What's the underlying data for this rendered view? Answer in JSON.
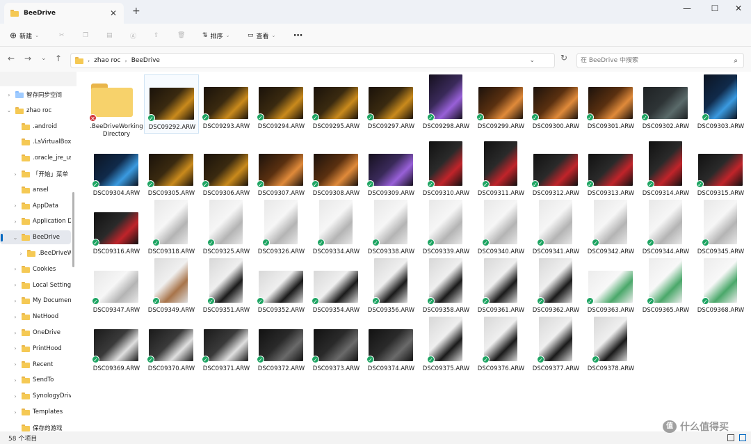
{
  "window": {
    "tab_title": "BeeDrive",
    "tab_close_icon": "close-icon",
    "new_tab_icon": "plus-icon",
    "controls": [
      "minimize-icon",
      "maximize-icon",
      "close-icon"
    ]
  },
  "toolbar": {
    "new_label": "新建",
    "sort_label": "排序",
    "view_label": "查看",
    "more_icon": "more-icon",
    "disabled_icons": [
      "cut-icon",
      "copy-icon",
      "paste-icon",
      "rename-icon",
      "share-icon",
      "delete-icon"
    ]
  },
  "address": {
    "crumbs": [
      "zhao roc",
      "BeeDrive"
    ],
    "search_placeholder": "在 BeeDrive 中搜索"
  },
  "sidebar": {
    "items": [
      {
        "label": "智存同步空间",
        "level": 0,
        "chev": "›",
        "icon": "sync-icon"
      },
      {
        "label": "zhao roc",
        "level": 0,
        "chev": "⌄",
        "icon": "folder-icon"
      },
      {
        "label": ".android",
        "level": 1,
        "chev": "",
        "icon": "folder-icon"
      },
      {
        "label": ".LsVirtualBox",
        "level": 1,
        "chev": "",
        "icon": "folder-icon"
      },
      {
        "label": ".oracle_jre_usage",
        "level": 1,
        "chev": "",
        "icon": "folder-icon"
      },
      {
        "label": "「开始」菜单",
        "level": 1,
        "chev": "›",
        "icon": "folder-icon"
      },
      {
        "label": "ansel",
        "level": 1,
        "chev": "",
        "icon": "folder-icon"
      },
      {
        "label": "AppData",
        "level": 1,
        "chev": "›",
        "icon": "folder-icon"
      },
      {
        "label": "Application Data",
        "level": 1,
        "chev": "›",
        "icon": "folder-icon"
      },
      {
        "label": "BeeDrive",
        "level": 1,
        "chev": "⌄",
        "icon": "folder-icon",
        "selected": true
      },
      {
        "label": ".BeeDriveWorkingDirectory",
        "level": 2,
        "chev": "›",
        "icon": "folder-icon"
      },
      {
        "label": "Cookies",
        "level": 1,
        "chev": "›",
        "icon": "folder-icon"
      },
      {
        "label": "Local Settings",
        "level": 1,
        "chev": "›",
        "icon": "folder-icon"
      },
      {
        "label": "My Documents",
        "level": 1,
        "chev": "›",
        "icon": "folder-icon"
      },
      {
        "label": "NetHood",
        "level": 1,
        "chev": "›",
        "icon": "folder-icon"
      },
      {
        "label": "OneDrive",
        "level": 1,
        "chev": "›",
        "icon": "folder-icon"
      },
      {
        "label": "PrintHood",
        "level": 1,
        "chev": "›",
        "icon": "folder-icon"
      },
      {
        "label": "Recent",
        "level": 1,
        "chev": "›",
        "icon": "folder-icon"
      },
      {
        "label": "SendTo",
        "level": 1,
        "chev": "›",
        "icon": "folder-icon"
      },
      {
        "label": "SynologyDrive",
        "level": 1,
        "chev": "›",
        "icon": "folder-icon"
      },
      {
        "label": "Templates",
        "level": 1,
        "chev": "›",
        "icon": "folder-icon"
      },
      {
        "label": "保存的游戏",
        "level": 1,
        "chev": "",
        "icon": "folder-icon"
      }
    ]
  },
  "files": [
    {
      "name": ".BeeDriveWorkingDirectory",
      "kind": "folder",
      "status": "error"
    },
    {
      "name": "DSC09292.ARW",
      "shape": "land",
      "scene": "rgb-gold",
      "selected": true
    },
    {
      "name": "DSC09293.ARW",
      "shape": "land",
      "scene": "rgb-gold"
    },
    {
      "name": "DSC09294.ARW",
      "shape": "land",
      "scene": "rgb-gold"
    },
    {
      "name": "DSC09295.ARW",
      "shape": "land",
      "scene": "rgb-gold"
    },
    {
      "name": "DSC09297.ARW",
      "shape": "land",
      "scene": "rgb-gold"
    },
    {
      "name": "DSC09298.ARW",
      "shape": "port",
      "scene": "rgb-purple"
    },
    {
      "name": "DSC09299.ARW",
      "shape": "land",
      "scene": "rgb-orange"
    },
    {
      "name": "DSC09300.ARW",
      "shape": "land",
      "scene": "rgb-orange"
    },
    {
      "name": "DSC09301.ARW",
      "shape": "land",
      "scene": "rgb-orange"
    },
    {
      "name": "DSC09302.ARW",
      "shape": "land",
      "scene": "dark-gray"
    },
    {
      "name": "DSC09303.ARW",
      "shape": "port",
      "scene": "rgb-blue"
    },
    {
      "name": "DSC09304.ARW",
      "shape": "land",
      "scene": "rgb-blue"
    },
    {
      "name": "DSC09305.ARW",
      "shape": "land",
      "scene": "rgb-gold"
    },
    {
      "name": "DSC09306.ARW",
      "shape": "land",
      "scene": "rgb-gold"
    },
    {
      "name": "DSC09307.ARW",
      "shape": "land",
      "scene": "rgb-orange"
    },
    {
      "name": "DSC09308.ARW",
      "shape": "land",
      "scene": "rgb-orange"
    },
    {
      "name": "DSC09309.ARW",
      "shape": "land",
      "scene": "rgb-purple"
    },
    {
      "name": "DSC09310.ARW",
      "shape": "port",
      "scene": "black-red"
    },
    {
      "name": "DSC09311.ARW",
      "shape": "port",
      "scene": "black-red"
    },
    {
      "name": "DSC09312.ARW",
      "shape": "land",
      "scene": "black-red"
    },
    {
      "name": "DSC09313.ARW",
      "shape": "land",
      "scene": "black-red"
    },
    {
      "name": "DSC09314.ARW",
      "shape": "port",
      "scene": "black-red"
    },
    {
      "name": "DSC09315.ARW",
      "shape": "land",
      "scene": "black-red"
    },
    {
      "name": "DSC09316.ARW",
      "shape": "land",
      "scene": "black-red"
    },
    {
      "name": "DSC09318.ARW",
      "shape": "port",
      "scene": "white"
    },
    {
      "name": "DSC09325.ARW",
      "shape": "port",
      "scene": "white"
    },
    {
      "name": "DSC09326.ARW",
      "shape": "port",
      "scene": "white"
    },
    {
      "name": "DSC09334.ARW",
      "shape": "port",
      "scene": "white"
    },
    {
      "name": "DSC09338.ARW",
      "shape": "port",
      "scene": "white"
    },
    {
      "name": "DSC09339.ARW",
      "shape": "port",
      "scene": "white"
    },
    {
      "name": "DSC09340.ARW",
      "shape": "port",
      "scene": "white"
    },
    {
      "name": "DSC09341.ARW",
      "shape": "port",
      "scene": "white"
    },
    {
      "name": "DSC09342.ARW",
      "shape": "port",
      "scene": "white"
    },
    {
      "name": "DSC09344.ARW",
      "shape": "port",
      "scene": "white"
    },
    {
      "name": "DSC09345.ARW",
      "shape": "port",
      "scene": "white"
    },
    {
      "name": "DSC09347.ARW",
      "shape": "land",
      "scene": "white"
    },
    {
      "name": "DSC09349.ARW",
      "shape": "port",
      "scene": "brown"
    },
    {
      "name": "DSC09351.ARW",
      "shape": "port",
      "scene": "black-box"
    },
    {
      "name": "DSC09352.ARW",
      "shape": "land",
      "scene": "black-box"
    },
    {
      "name": "DSC09354.ARW",
      "shape": "land",
      "scene": "black-box"
    },
    {
      "name": "DSC09356.ARW",
      "shape": "port",
      "scene": "black-box"
    },
    {
      "name": "DSC09358.ARW",
      "shape": "port",
      "scene": "black-box"
    },
    {
      "name": "DSC09361.ARW",
      "shape": "port",
      "scene": "black-box"
    },
    {
      "name": "DSC09362.ARW",
      "shape": "port",
      "scene": "black-box"
    },
    {
      "name": "DSC09363.ARW",
      "shape": "land",
      "scene": "green-white"
    },
    {
      "name": "DSC09365.ARW",
      "shape": "port",
      "scene": "green-white"
    },
    {
      "name": "DSC09368.ARW",
      "shape": "port",
      "scene": "green-white"
    },
    {
      "name": "DSC09369.ARW",
      "shape": "land",
      "scene": "ssd"
    },
    {
      "name": "DSC09370.ARW",
      "shape": "land",
      "scene": "ssd"
    },
    {
      "name": "DSC09371.ARW",
      "shape": "land",
      "scene": "ssd"
    },
    {
      "name": "DSC09372.ARW",
      "shape": "land",
      "scene": "ssd-dark"
    },
    {
      "name": "DSC09373.ARW",
      "shape": "land",
      "scene": "ssd-dark"
    },
    {
      "name": "DSC09374.ARW",
      "shape": "land",
      "scene": "ssd-dark"
    },
    {
      "name": "DSC09375.ARW",
      "shape": "port",
      "scene": "black-box"
    },
    {
      "name": "DSC09376.ARW",
      "shape": "port",
      "scene": "black-box"
    },
    {
      "name": "DSC09377.ARW",
      "shape": "port",
      "scene": "black-box"
    },
    {
      "name": "DSC09378.ARW",
      "shape": "port",
      "scene": "black-box"
    }
  ],
  "status": {
    "count_text": "58 个项目"
  },
  "watermark": {
    "logo_text": "值",
    "text": "什么值得买"
  }
}
